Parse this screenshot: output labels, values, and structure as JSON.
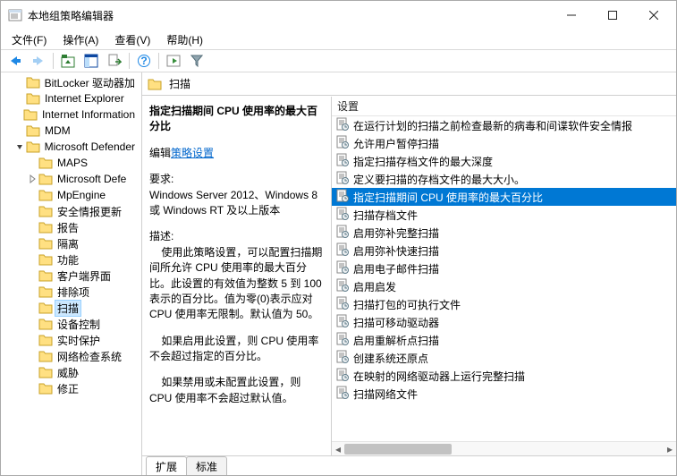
{
  "window": {
    "title": "本地组策略编辑器"
  },
  "menu": {
    "file": "文件(F)",
    "action": "操作(A)",
    "view": "查看(V)",
    "help": "帮助(H)"
  },
  "tree": [
    {
      "indent": 1,
      "twisty": "",
      "label": "BitLocker 驱动器加"
    },
    {
      "indent": 1,
      "twisty": "",
      "label": "Internet Explorer"
    },
    {
      "indent": 1,
      "twisty": "",
      "label": "Internet Information"
    },
    {
      "indent": 1,
      "twisty": "",
      "label": "MDM"
    },
    {
      "indent": 1,
      "twisty": "open",
      "label": "Microsoft Defender"
    },
    {
      "indent": 2,
      "twisty": "",
      "label": "MAPS"
    },
    {
      "indent": 2,
      "twisty": "closed",
      "label": "Microsoft Defe"
    },
    {
      "indent": 2,
      "twisty": "",
      "label": "MpEngine"
    },
    {
      "indent": 2,
      "twisty": "",
      "label": "安全情报更新"
    },
    {
      "indent": 2,
      "twisty": "",
      "label": "报告"
    },
    {
      "indent": 2,
      "twisty": "",
      "label": "隔离"
    },
    {
      "indent": 2,
      "twisty": "",
      "label": "功能"
    },
    {
      "indent": 2,
      "twisty": "",
      "label": "客户端界面"
    },
    {
      "indent": 2,
      "twisty": "",
      "label": "排除项"
    },
    {
      "indent": 2,
      "twisty": "",
      "label": "扫描",
      "selected": true
    },
    {
      "indent": 2,
      "twisty": "",
      "label": "设备控制"
    },
    {
      "indent": 2,
      "twisty": "",
      "label": "实时保护"
    },
    {
      "indent": 2,
      "twisty": "",
      "label": "网络检查系统"
    },
    {
      "indent": 2,
      "twisty": "",
      "label": "威胁"
    },
    {
      "indent": 2,
      "twisty": "",
      "label": "修正"
    }
  ],
  "panel": {
    "header": "扫描",
    "title": "指定扫描期间 CPU 使用率的最大百分比",
    "edit_label": "编辑",
    "edit_link": "策略设置",
    "req_label": "要求:",
    "req_text": "Windows Server 2012、Windows 8 或 Windows RT 及以上版本",
    "desc_label": "描述:",
    "desc1": "    使用此策略设置，可以配置扫描期间所允许 CPU 使用率的最大百分比。此设置的有效值为整数 5 到 100 表示的百分比。值为零(0)表示应对 CPU 使用率无限制。默认值为 50。",
    "desc2": "    如果启用此设置，则 CPU 使用率不会超过指定的百分比。",
    "desc3": "    如果禁用或未配置此设置，则 CPU 使用率不会超过默认值。"
  },
  "list": {
    "header": "设置",
    "items": [
      "在运行计划的扫描之前检查最新的病毒和间谍软件安全情报",
      "允许用户暂停扫描",
      "指定扫描存档文件的最大深度",
      "定义要扫描的存档文件的最大大小。",
      "指定扫描期间 CPU 使用率的最大百分比",
      "扫描存档文件",
      "启用弥补完整扫描",
      "启用弥补快速扫描",
      "启用电子邮件扫描",
      "启用启发",
      "扫描打包的可执行文件",
      "扫描可移动驱动器",
      "启用重解析点扫描",
      "创建系统还原点",
      "在映射的网络驱动器上运行完整扫描",
      "扫描网络文件"
    ],
    "selected_index": 4
  },
  "tabs": {
    "extended": "扩展",
    "standard": "标准"
  }
}
